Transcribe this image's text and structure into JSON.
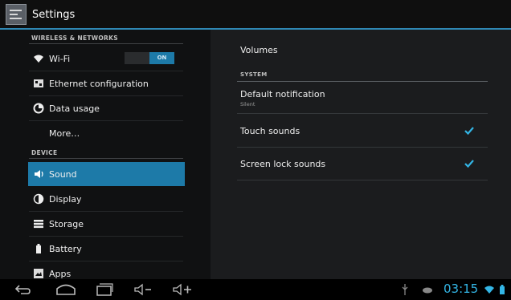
{
  "app": {
    "title": "Settings",
    "icon": "settings-icon"
  },
  "colors": {
    "accent": "#1d7aa8",
    "clock": "#33b5e5"
  },
  "sidebar": {
    "headers": [
      "WIRELESS & NETWORKS",
      "DEVICE"
    ],
    "items": [
      {
        "label": "Wi-Fi",
        "icon": "wifi-icon",
        "toggle": "ON"
      },
      {
        "label": "Ethernet configuration",
        "icon": "ethernet-icon"
      },
      {
        "label": "Data usage",
        "icon": "data-usage-icon"
      },
      {
        "label": "More…"
      },
      {
        "label": "Sound",
        "icon": "sound-icon",
        "selected": true
      },
      {
        "label": "Display",
        "icon": "display-icon"
      },
      {
        "label": "Storage",
        "icon": "storage-icon"
      },
      {
        "label": "Battery",
        "icon": "battery-icon"
      },
      {
        "label": "Apps",
        "icon": "apps-icon"
      }
    ]
  },
  "main": {
    "volumes": "Volumes",
    "system_header": "SYSTEM",
    "default_notification": {
      "label": "Default notification",
      "value": "Silent"
    },
    "touch_sounds": {
      "label": "Touch sounds",
      "checked": true
    },
    "screen_lock_sounds": {
      "label": "Screen lock sounds",
      "checked": true
    }
  },
  "statusbar": {
    "time": "03:15"
  }
}
